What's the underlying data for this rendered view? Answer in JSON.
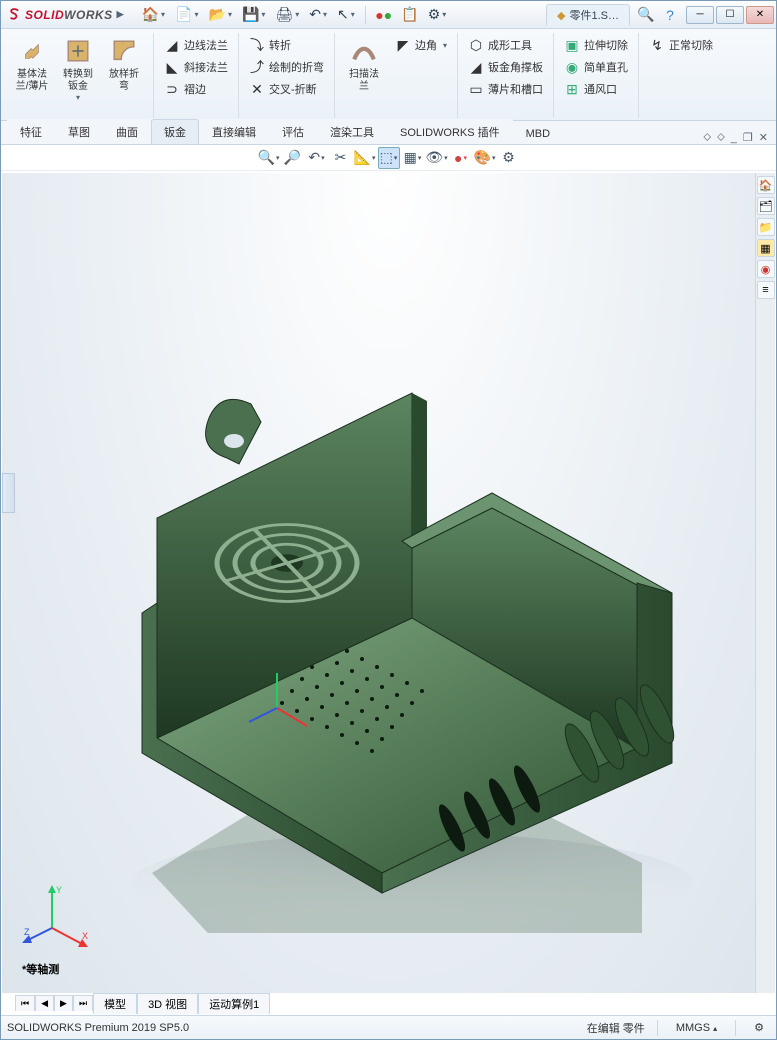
{
  "app": {
    "brand_solid": "SOLID",
    "brand_works": "WORKS",
    "doc_tab": "零件1.S…"
  },
  "titlebar_icons": [
    "home",
    "recent",
    "open",
    "save",
    "print",
    "undo",
    "redo",
    "select",
    "rebuild",
    "options"
  ],
  "ribbon": {
    "big": [
      {
        "label": "基体法\n兰/薄片"
      },
      {
        "label": "转换到\n钣金"
      },
      {
        "label": "放样折\n弯"
      }
    ],
    "col1": [
      "边线法兰",
      "斜接法兰",
      "褶边"
    ],
    "col2": [
      "转折",
      "绘制的折弯",
      "交叉-折断"
    ],
    "big2": {
      "label": "扫描法\n兰"
    },
    "col3": [
      "边角"
    ],
    "col4": [
      "成形工具",
      "钣金角撑板",
      "薄片和槽口"
    ],
    "col5": [
      "拉伸切除",
      "简单直孔",
      "通风口"
    ],
    "col6": [
      "正常切除"
    ]
  },
  "tabs": [
    "特征",
    "草图",
    "曲面",
    "钣金",
    "直接编辑",
    "评估",
    "渲染工具",
    "SOLIDWORKS 插件",
    "MBD"
  ],
  "active_tab": "钣金",
  "view_label": "*等轴测",
  "bottom_tabs": [
    "模型",
    "3D 视图",
    "运动算例1"
  ],
  "status": {
    "left": "SOLIDWORKS Premium 2019 SP5.0",
    "mode": "在编辑 零件",
    "units": "MMGS"
  },
  "triad_axes": {
    "x": "X",
    "y": "Y",
    "z": "Z"
  }
}
